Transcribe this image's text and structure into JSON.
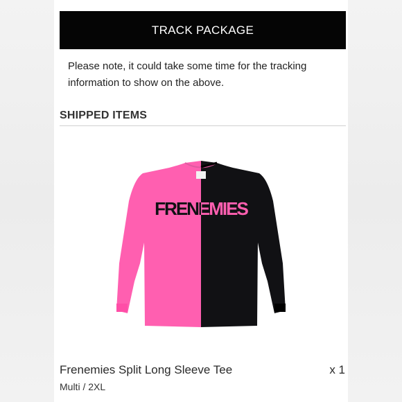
{
  "track_button": {
    "label": "TRACK PACKAGE"
  },
  "note": {
    "text": "Please note, it could take some time for the tracking information to show on the above."
  },
  "shipped_section": {
    "title": "SHIPPED ITEMS"
  },
  "item": {
    "name": "Frenemies Split Long Sleeve Tee",
    "variant": "Multi / 2XL",
    "quantity": "x 1",
    "print_text": "FRENEMIES",
    "colors": {
      "pink": "#ff5fb0",
      "black": "#111114"
    }
  }
}
